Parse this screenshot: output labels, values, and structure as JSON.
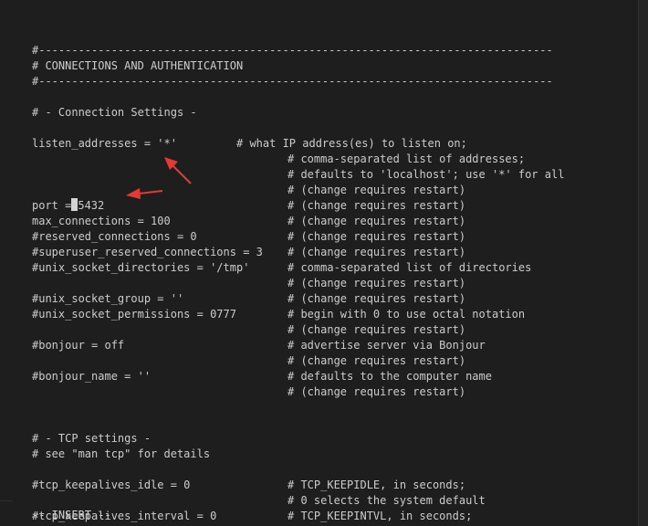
{
  "editor": {
    "lines": [
      {
        "code": "#------------------------------------------------------------------------------",
        "comment": ""
      },
      {
        "code": "# CONNECTIONS AND AUTHENTICATION",
        "comment": ""
      },
      {
        "code": "#------------------------------------------------------------------------------",
        "comment": ""
      },
      {
        "code": "",
        "comment": ""
      },
      {
        "code": "# - Connection Settings -",
        "comment": ""
      },
      {
        "code": "",
        "comment": ""
      },
      {
        "code": "listen_addresses = '*'",
        "comment": "# what IP address(es) to listen on;",
        "inline": true
      },
      {
        "code": "",
        "comment": "# comma-separated list of addresses;"
      },
      {
        "code": "",
        "comment": "# defaults to 'localhost'; use '*' for all"
      },
      {
        "code": "",
        "comment": "# (change requires restart)"
      },
      {
        "code": "port = 5432",
        "comment": "# (change requires restart)",
        "cursor": true
      },
      {
        "code": "max_connections = 100",
        "comment": "# (change requires restart)"
      },
      {
        "code": "#reserved_connections = 0",
        "comment": "# (change requires restart)"
      },
      {
        "code": "#superuser_reserved_connections = 3",
        "comment": "# (change requires restart)"
      },
      {
        "code": "#unix_socket_directories = '/tmp'",
        "comment": "# comma-separated list of directories"
      },
      {
        "code": "",
        "comment": "# (change requires restart)"
      },
      {
        "code": "#unix_socket_group = ''",
        "comment": "# (change requires restart)"
      },
      {
        "code": "#unix_socket_permissions = 0777",
        "comment": "# begin with 0 to use octal notation"
      },
      {
        "code": "",
        "comment": "# (change requires restart)"
      },
      {
        "code": "#bonjour = off",
        "comment": "# advertise server via Bonjour"
      },
      {
        "code": "",
        "comment": "# (change requires restart)"
      },
      {
        "code": "#bonjour_name = ''",
        "comment": "# defaults to the computer name"
      },
      {
        "code": "",
        "comment": "# (change requires restart)"
      },
      {
        "code": "",
        "comment": ""
      },
      {
        "code": "",
        "comment": ""
      },
      {
        "code": "# - TCP settings -",
        "comment": ""
      },
      {
        "code": "# see \"man tcp\" for details",
        "comment": ""
      },
      {
        "code": "",
        "comment": ""
      },
      {
        "code": "#tcp_keepalives_idle = 0",
        "comment": "# TCP_KEEPIDLE, in seconds;"
      },
      {
        "code": "",
        "comment": "# 0 selects the system default"
      },
      {
        "code": "#tcp_keepalives_interval = 0",
        "comment": "# TCP_KEEPINTVL, in seconds;"
      }
    ],
    "status": "-- INSERT --"
  },
  "colors": {
    "background": "#1e1e1e",
    "text": "#cccccc",
    "annotation_arrow": "#e53935"
  }
}
